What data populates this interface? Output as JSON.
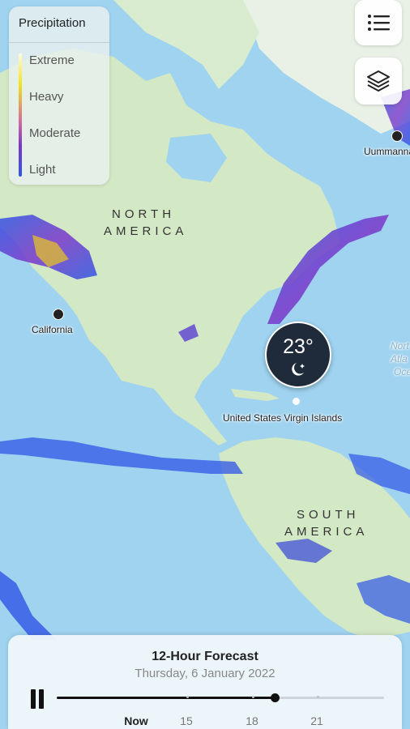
{
  "legend": {
    "title": "Precipitation",
    "levels": [
      "Extreme",
      "Heavy",
      "Moderate",
      "Light"
    ]
  },
  "controls": {
    "list_icon": "list-icon",
    "layers_icon": "layers-icon"
  },
  "map": {
    "regions": {
      "north_america_line1": "NORTH",
      "north_america_line2": "AMERICA",
      "south_america_line1": "SOUTH",
      "south_america_line2": "AMERICA"
    },
    "places": {
      "california": "California",
      "uvi": "United States Virgin Islands",
      "ummannaq": "Uummannaq",
      "atlantic_partial_1": "Nort",
      "atlantic_partial_2": "Atla",
      "atlantic_partial_3": "Oce"
    },
    "weather_bubble": {
      "temperature": "23°",
      "icon": "moon-stars-icon"
    }
  },
  "forecast": {
    "title": "12-Hour Forecast",
    "date": "Thursday, 6 January 2022",
    "progress": 0.665,
    "play_state": "pause-icon",
    "ticks": [
      "Now",
      "15",
      "18",
      "21"
    ]
  }
}
